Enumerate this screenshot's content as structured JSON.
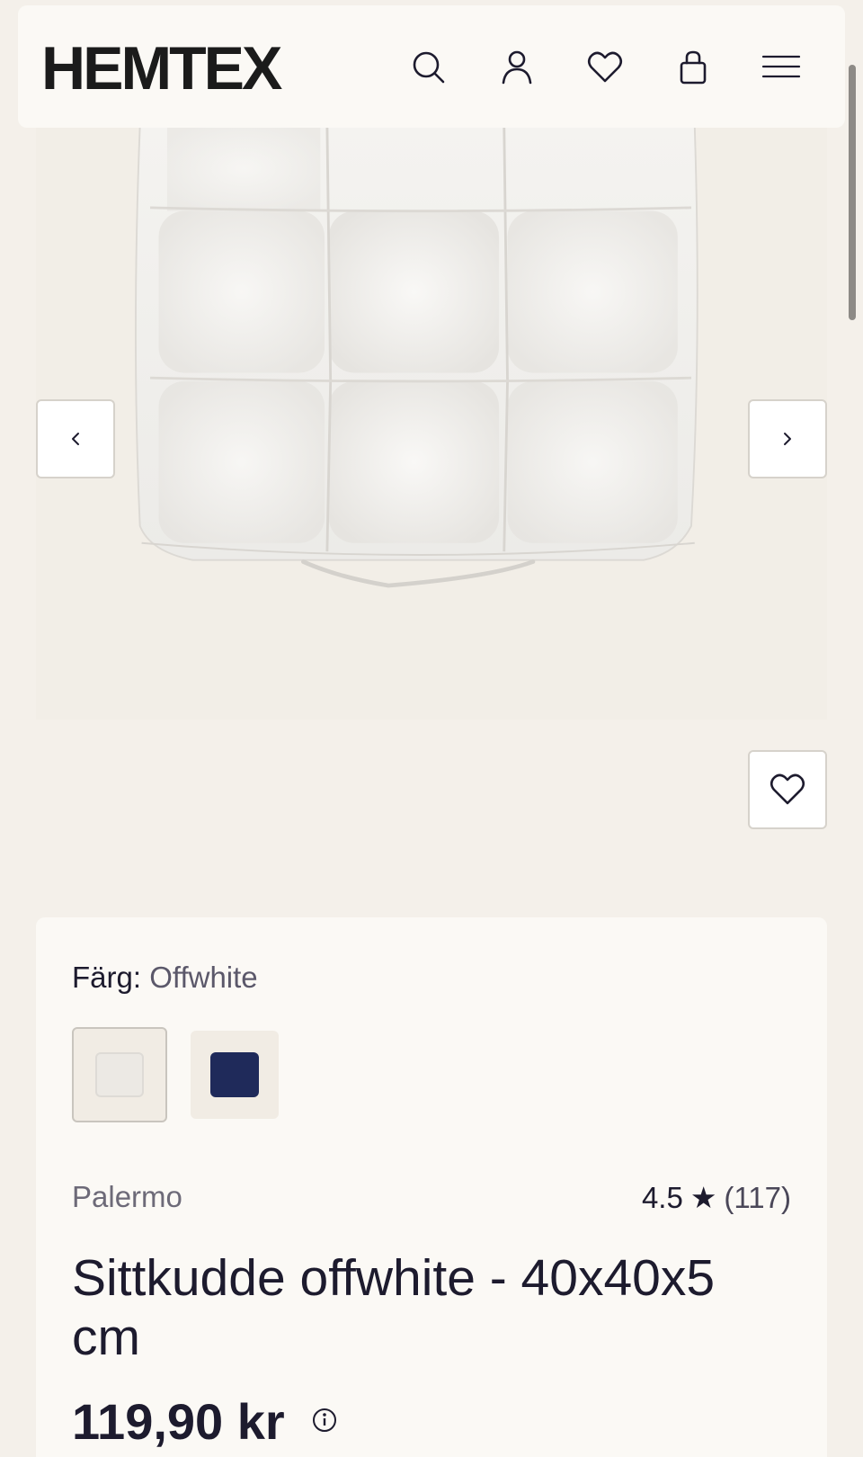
{
  "header": {
    "logo": "HEMTEX",
    "icons": [
      "search-icon",
      "user-icon",
      "heart-icon",
      "bag-icon",
      "menu-icon"
    ]
  },
  "gallery": {
    "prev_icon": "chevron-left-icon",
    "next_icon": "chevron-right-icon",
    "favorite_icon": "heart-icon"
  },
  "product": {
    "color_label": "Färg:",
    "color_value": "Offwhite",
    "swatches": [
      {
        "name": "Offwhite",
        "color": "#ece9e4",
        "selected": true
      },
      {
        "name": "Navy",
        "color": "#1f2a5a",
        "selected": false
      }
    ],
    "brand": "Palermo",
    "rating": "4.5",
    "rating_star": "★",
    "review_count": "(117)",
    "title": "Sittkudde offwhite - 40x40x5 cm",
    "price": "119,90 kr"
  },
  "colors": {
    "background": "#f4f0ea",
    "card": "#fbf9f5",
    "text": "#1d1b2e"
  }
}
